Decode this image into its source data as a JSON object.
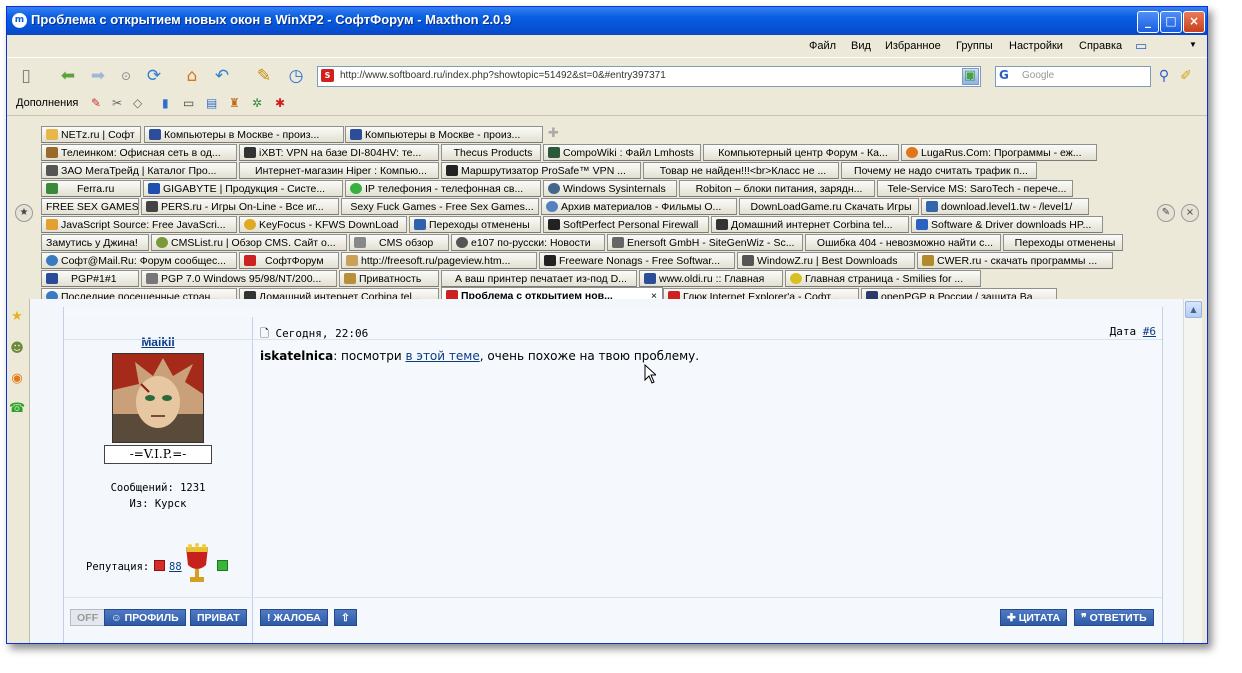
{
  "window": {
    "title": "Проблема с открытием новых окон в WinXP2 - СофтФорум - Maxthon 2.0.9",
    "controls": [
      "_",
      "□",
      "×"
    ]
  },
  "menu": [
    "Файл",
    "Вид",
    "Избранное",
    "Группы",
    "Настройки",
    "Справка"
  ],
  "address": {
    "url": "http://www.softboard.ru/index.php?showtopic=51492&st=0&#entry397371",
    "search_placeholder": "Google"
  },
  "addons_label": "Дополнения",
  "tabs": [
    [
      "NETz.ru | Софт",
      "Компьютеры в Москве - произ...",
      "Компьютеры в Москве - произ..."
    ],
    [
      "Телеинком: Офисная сеть в од...",
      "iXBT: VPN на базе DI-804HV: те...",
      "Thecus Products",
      "CompoWiki : Файл Lmhosts",
      "Компьютерный центр Форум - Ка...",
      "LugaRus.Com: Программы - еж..."
    ],
    [
      "ЗАО МегаТрейд | Каталог Про...",
      "Интернет-магазин Hiper : Компью...",
      "Маршрутизатор ProSafe™ VPN ...",
      "Товар не найден!!!<br>Класс не ...",
      "Почему не надо считать трафик п..."
    ],
    [
      "Ferra.ru",
      "GIGABYTE | Продукция - Систе...",
      "IP телефония - телефонная св...",
      "Windows Sysinternals",
      "Robiton – блоки питания, зарядн...",
      "Tele-Service MS: SaroTech - перече..."
    ],
    [
      "FREE SEX GAMES",
      "PERS.ru - Игры On-Line - Все иг...",
      "Sexy Fuck Games - Free Sex Games...",
      "Архив материалов - Фильмы О...",
      "DownLoadGame.ru Скачать Игры",
      "download.level1.tw - /level1/"
    ],
    [
      "JavaScript Source: Free JavaScri...",
      "KeyFocus - KFWS DownLoad",
      "Переходы отменены",
      "SoftPerfect Personal Firewall",
      "Домашний интернет Corbina tel...",
      "Software & Driver downloads HP..."
    ],
    [
      "Замутись у Джина!",
      "CMSList.ru | Обзор CMS. Сайт о...",
      "CMS обзор",
      "e107 по-русски: Новости",
      "Enersoft GmbH - SiteGenWiz - Sc...",
      "Ошибка 404 - невозможно найти с...",
      "Переходы отменены"
    ],
    [
      "Софт@Mail.Ru: Форум сообщес...",
      "СофтФорум",
      "http://freesoft.ru/pageview.htm...",
      "Freeware Nonags - Free Softwar...",
      "WindowZ.ru | Best Downloads",
      "CWER.ru - скачать программы ..."
    ],
    [
      "PGP#1#1",
      "PGP 7.0 Windows 95/98/NT/200...",
      "Приватность",
      "А ваш принтер печатает из-под D...",
      "www.oldi.ru :: Главная",
      "Главная страница - Smilies for ..."
    ],
    [
      "Последние посещенные стран...",
      "Домашний интернет Corbina tel...",
      "Проблема с открытием нов...",
      "Глюк Internet Explorer'а - Софт...",
      "openPGP в России / защита Ва..."
    ]
  ],
  "post": {
    "username": "Maikll",
    "rank": "-=V.I.P.=-",
    "messages": "Сообщений: 1231",
    "from": "Из: Курск",
    "reputation_label": "Репутация:",
    "reputation_value": "88",
    "date": "Сегодня, 22:06",
    "post_label": "Дата",
    "post_number": "#6",
    "addressee": "iskatelnica",
    "text_before": ": посмотри ",
    "link_text": "в этой теме",
    "text_after": ", очень похоже на твою проблему.",
    "buttons": {
      "off": "OFF",
      "profile": "ПРОФИЛЬ",
      "private": "ПРИВАТ",
      "report": "ЖАЛОБА",
      "up": "⇧",
      "quote": "ЦИТАТА",
      "reply": "ОТВЕТИТЬ"
    }
  },
  "colors": {
    "title_bar": "#0a5fe0",
    "link": "#0b3c86",
    "button": "#2e5aa6"
  }
}
